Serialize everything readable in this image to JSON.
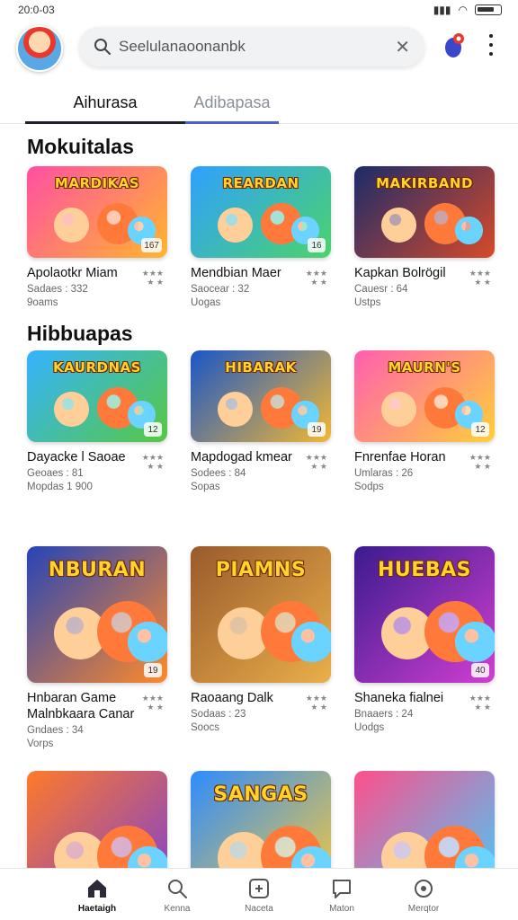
{
  "status": {
    "time": "20:0-03"
  },
  "search": {
    "text": "Seelulanaoonanbk"
  },
  "tabs": [
    {
      "label": "Aihurasa"
    },
    {
      "label": "Adibapasa"
    }
  ],
  "sections": [
    {
      "title": "Mokuitalas"
    },
    {
      "title": "Hibbuapas"
    }
  ],
  "cards": [
    {
      "title": "Apolaotkr Miam",
      "meta1": "Sadaes : 332",
      "meta2": "9oams",
      "banner": "MARDIKAS",
      "badge": "167",
      "bg1": "#ff4fa3",
      "bg2": "#ffb62e"
    },
    {
      "title": "Mendbian Maer",
      "meta1": "Saocear : 32",
      "meta2": "Uogas",
      "banner": "REARDAN",
      "badge": "16",
      "bg1": "#2fa0ff",
      "bg2": "#4cd36b"
    },
    {
      "title": "Kapkan Bolrögil",
      "meta1": "Cauesr : 64",
      "meta2": "Ustps",
      "banner": "MAKIRBAND",
      "badge": "",
      "bg1": "#1b2b6b",
      "bg2": "#d64a2a"
    },
    {
      "title": "Dayacke l Saoae",
      "meta1": "Geoaes : 81",
      "meta2": "Mopdas 1 900",
      "banner": "KAURDNAS",
      "badge": "12",
      "bg1": "#35b3ff",
      "bg2": "#57c842"
    },
    {
      "title": "Mapdogad kmear",
      "meta1": "Sodees : 84",
      "meta2": "Sopas",
      "banner": "HIBARAK",
      "badge": "19",
      "bg1": "#1956c9",
      "bg2": "#f2b733"
    },
    {
      "title": "Fnrenfae Horan",
      "meta1": "Umlaras : 26",
      "meta2": "Sodps",
      "banner": "MAURN'S",
      "badge": "12",
      "bg1": "#ff5fb0",
      "bg2": "#ffcf3a"
    },
    {
      "title": "Hnbaran Game",
      "title2": "Malnbkaara Canar",
      "meta1": "Gndaes : 34",
      "meta2": "Vorps",
      "banner": "NBURAN",
      "badge": "19",
      "bg1": "#2544b8",
      "bg2": "#ff8a2a"
    },
    {
      "title": "Raoaang Dalk",
      "meta1": "Sodaas : 23",
      "meta2": "Soocs",
      "banner": "PIAMNS",
      "badge": "",
      "bg1": "#9b5a2c",
      "bg2": "#e9b04a"
    },
    {
      "title": "Shaneka fialnei",
      "meta1": "Bnaaers : 24",
      "meta2": "Uodgs",
      "banner": "HUEBAS",
      "badge": "40",
      "bg1": "#3a1b8f",
      "bg2": "#d13fd0"
    },
    {
      "title": "",
      "meta1": "",
      "meta2": "",
      "banner": "",
      "badge": "",
      "bg1": "#ff7a2a",
      "bg2": "#7b3fd4"
    },
    {
      "title": "",
      "meta1": "",
      "meta2": "",
      "banner": "SANGAS",
      "badge": "",
      "bg1": "#2d8cff",
      "bg2": "#ffcc33"
    },
    {
      "title": "",
      "meta1": "",
      "meta2": "",
      "banner": "",
      "badge": "",
      "bg1": "#ff4f8b",
      "bg2": "#3fd0ff"
    }
  ],
  "bottom_nav": [
    {
      "label": "Haetaigh",
      "icon": "home-icon"
    },
    {
      "label": "Kenna",
      "icon": "search-icon"
    },
    {
      "label": "Naceta",
      "icon": "add-icon"
    },
    {
      "label": "Maton",
      "icon": "chat-icon"
    },
    {
      "label": "Merqtor",
      "icon": "explore-icon"
    }
  ],
  "colors": {
    "accent": "#4b63c9",
    "text": "#111111",
    "muted": "#666666"
  }
}
